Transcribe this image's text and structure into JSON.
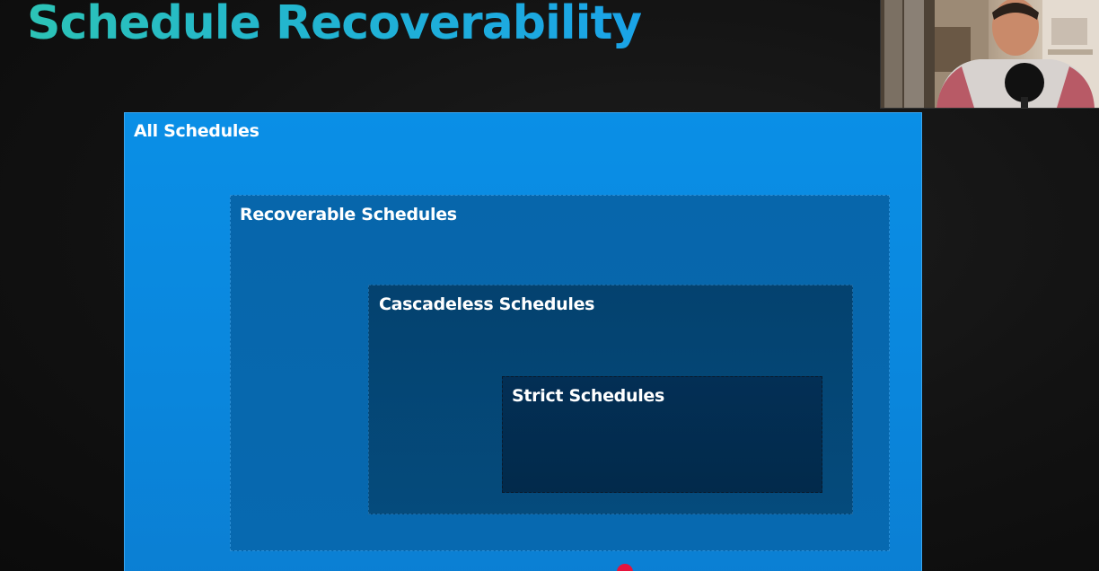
{
  "slide": {
    "title": "Schedule Recoverability"
  },
  "diagram": {
    "sets": [
      {
        "label": "All Schedules"
      },
      {
        "label": "Recoverable Schedules"
      },
      {
        "label": "Cascadeless Schedules"
      },
      {
        "label": "Strict Schedules"
      }
    ]
  },
  "webcam": {
    "icon": "presenter-video-icon"
  },
  "pointer": {
    "icon": "laser-pointer-icon",
    "color": "#e5133c"
  },
  "colors": {
    "title": "#22b8cf",
    "all_schedules": "#0a8fe6",
    "recoverable": "#0766ab",
    "cascadeless": "#04426f",
    "strict": "#032f55"
  }
}
